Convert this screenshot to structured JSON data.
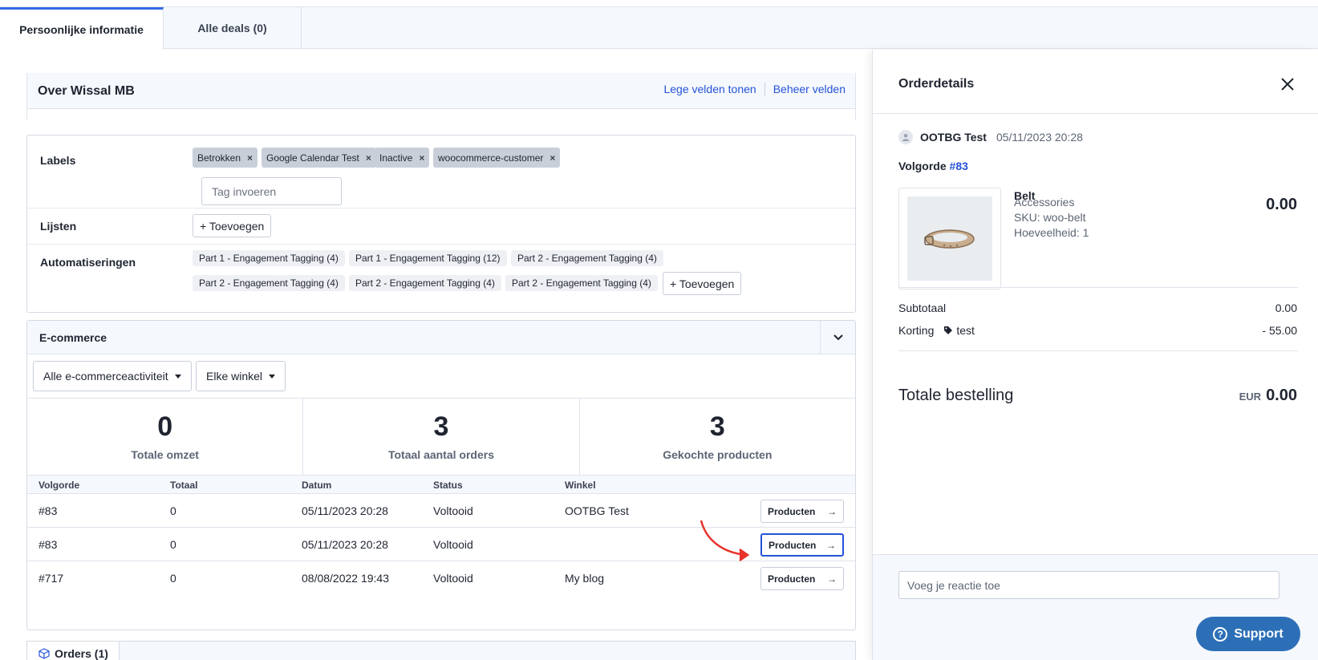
{
  "tabs": [
    {
      "label": "Persoonlijke informatie"
    },
    {
      "label": "Alle deals (0)"
    }
  ],
  "about": {
    "title": "Over Wissal MB",
    "show_empty": "Lege velden tonen",
    "manage_fields": "Beheer velden"
  },
  "labels_section": {
    "labels_title": "Labels",
    "chips": [
      "Betrokken",
      "Google Calendar Test",
      "Inactive",
      "woocommerce-customer"
    ],
    "chip_remove": "×",
    "tag_placeholder": "Tag invoeren",
    "lists_title": "Lijsten",
    "add_label": "+ Toevoegen",
    "automations_title": "Automatiseringen",
    "automations": [
      "Part 1 - Engagement Tagging  (4)",
      "Part 1 - Engagement Tagging  (12)",
      "Part 2 - Engagement Tagging  (4)",
      "Part 2 - Engagement Tagging  (4)",
      "Part 2 - Engagement Tagging  (4)",
      "Part 2 - Engagement Tagging  (4)"
    ]
  },
  "ecommerce": {
    "title": "E-commerce",
    "filter_activity": "Alle e-commerceactiviteit",
    "filter_store": "Elke winkel",
    "stats": [
      {
        "value": "0",
        "label": "Totale omzet"
      },
      {
        "value": "3",
        "label": "Totaal aantal orders"
      },
      {
        "value": "3",
        "label": "Gekochte producten"
      }
    ],
    "columns": [
      "Volgorde",
      "Totaal",
      "Datum",
      "Status",
      "Winkel"
    ],
    "rows": [
      {
        "order": "#83",
        "total": "0",
        "date": "05/11/2023 20:28",
        "status": "Voltooid",
        "store": "OOTBG Test"
      },
      {
        "order": "#83",
        "total": "0",
        "date": "05/11/2023 20:28",
        "status": "Voltooid",
        "store": ""
      },
      {
        "order": "#717",
        "total": "0",
        "date": "08/08/2022 19:43",
        "status": "Voltooid",
        "store": "My blog"
      }
    ],
    "products_button": "Producten",
    "arrow": "→"
  },
  "orders_tab": {
    "label": "Orders (1)"
  },
  "panel": {
    "title": "Orderdetails",
    "store": "OOTBG Test",
    "date": "05/11/2023 20:28",
    "order_label": "Volgorde",
    "order_number": "#83",
    "product": {
      "name": "Belt",
      "category": "Accessories",
      "sku": "SKU: woo-belt",
      "quantity": "Hoeveelheid: 1",
      "price": "0.00"
    },
    "subtotal_label": "Subtotaal",
    "subtotal_value": "0.00",
    "discount_label": "Korting",
    "discount_code": "test",
    "discount_value": "- 55.00",
    "total_label": "Totale bestelling",
    "currency": "EUR",
    "total_value": "0.00",
    "comment_placeholder": "Voeg je reactie toe",
    "support_label": "Support"
  },
  "colors": {
    "accent": "#2553d8",
    "annotation_arrow": "#e8322b",
    "support": "#2c6fb7"
  }
}
